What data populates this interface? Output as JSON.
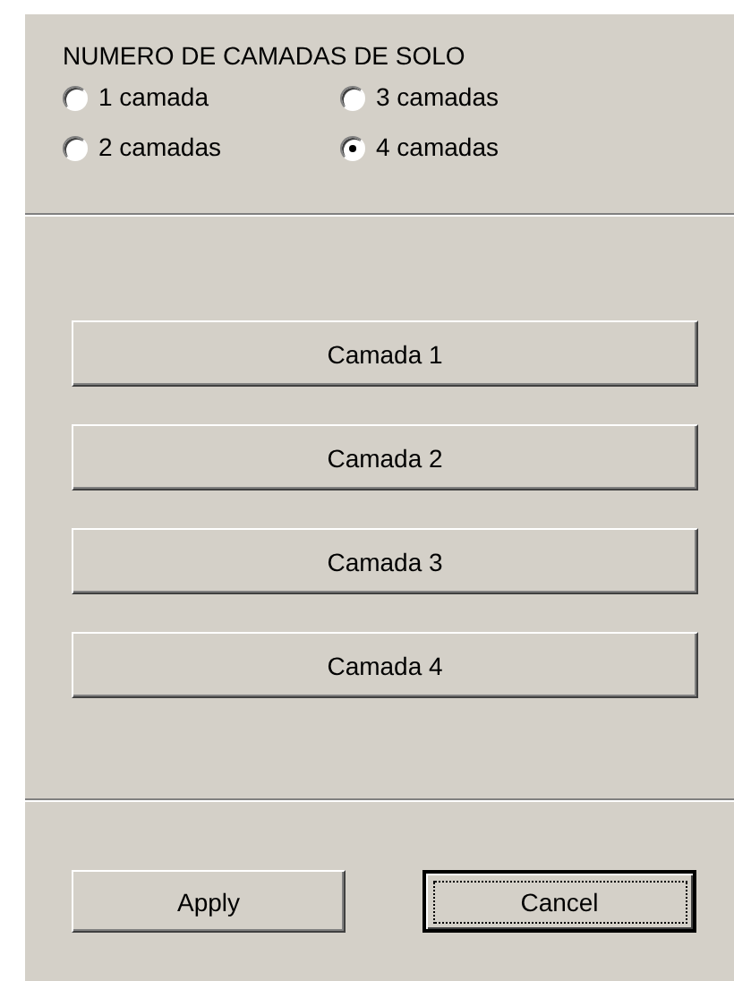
{
  "group": {
    "title": "NUMERO DE CAMADAS DE SOLO",
    "options": [
      {
        "label": "1 camada",
        "selected": false
      },
      {
        "label": "3 camadas",
        "selected": false
      },
      {
        "label": "2 camadas",
        "selected": false
      },
      {
        "label": "4 camadas",
        "selected": true
      }
    ]
  },
  "layer_buttons": [
    "Camada 1",
    "Camada 2",
    "Camada 3",
    "Camada 4"
  ],
  "footer_buttons": [
    {
      "label": "Apply",
      "focused": false
    },
    {
      "label": "Cancel",
      "focused": true
    }
  ]
}
